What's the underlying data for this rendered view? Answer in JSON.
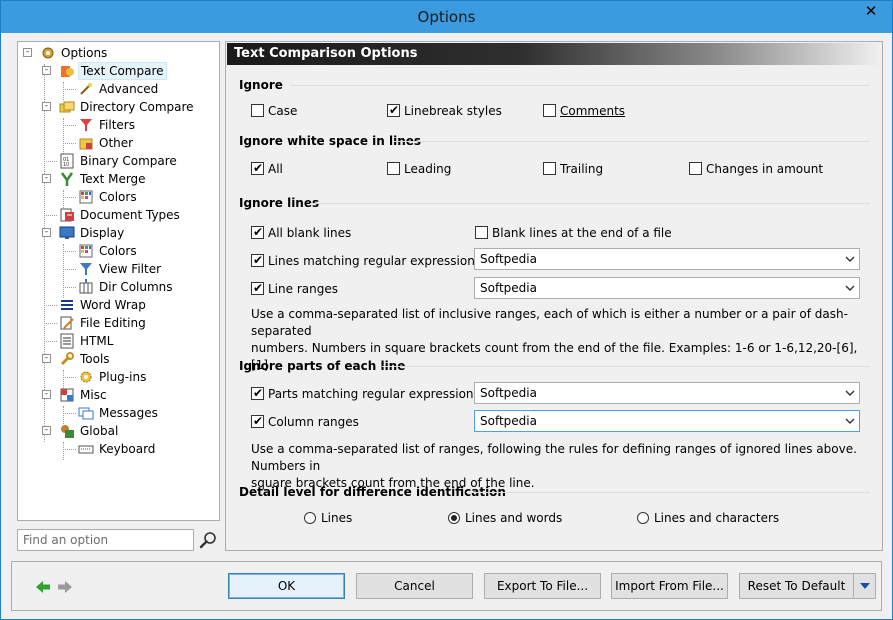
{
  "window": {
    "title": "Options",
    "close_glyph": "✕"
  },
  "tree": {
    "items": [
      {
        "label": "Options",
        "icon": "options-gear-icon"
      },
      {
        "label": "Text Compare",
        "icon": "text-compare-icon"
      },
      {
        "label": "Advanced",
        "icon": "advanced-wand-icon"
      },
      {
        "label": "Directory Compare",
        "icon": "folders-icon"
      },
      {
        "label": "Filters",
        "icon": "filter-funnel-icon"
      },
      {
        "label": "Other",
        "icon": "other-folder-icon"
      },
      {
        "label": "Binary Compare",
        "icon": "binary-icon"
      },
      {
        "label": "Text Merge",
        "icon": "merge-icon"
      },
      {
        "label": "Colors",
        "icon": "color-grid-icon"
      },
      {
        "label": "Document Types",
        "icon": "document-types-icon"
      },
      {
        "label": "Display",
        "icon": "monitor-icon"
      },
      {
        "label": "Colors",
        "icon": "color-grid-icon"
      },
      {
        "label": "View Filter",
        "icon": "view-filter-icon"
      },
      {
        "label": "Dir Columns",
        "icon": "dir-columns-icon"
      },
      {
        "label": "Word Wrap",
        "icon": "word-wrap-icon"
      },
      {
        "label": "File Editing",
        "icon": "file-editing-icon"
      },
      {
        "label": "HTML",
        "icon": "html-icon"
      },
      {
        "label": "Tools",
        "icon": "tools-wrench-icon"
      },
      {
        "label": "Plug-ins",
        "icon": "plugin-gear-icon"
      },
      {
        "label": "Misc",
        "icon": "misc-icon"
      },
      {
        "label": "Messages",
        "icon": "messages-icon"
      },
      {
        "label": "Global",
        "icon": "global-icon"
      },
      {
        "label": "Keyboard",
        "icon": "keyboard-icon"
      }
    ],
    "find_placeholder": "Find an option"
  },
  "panel": {
    "header": "Text Comparison Options",
    "ignore": {
      "title": "Ignore",
      "case": {
        "label": "Case",
        "checked": false
      },
      "linebreak": {
        "label": "Linebreak styles",
        "checked": true
      },
      "comments": {
        "label": "Comments",
        "checked": false
      }
    },
    "whitespace": {
      "title": "Ignore white space in lines",
      "all": {
        "label": "All",
        "checked": true
      },
      "leading": {
        "label": "Leading",
        "checked": false
      },
      "trailing": {
        "label": "Trailing",
        "checked": false
      },
      "changes": {
        "label": "Changes in amount",
        "checked": false
      }
    },
    "lines": {
      "title": "Ignore lines",
      "blank": {
        "label": "All blank lines",
        "checked": true
      },
      "blank_end": {
        "label": "Blank lines at the end of a file",
        "checked": false
      },
      "regex": {
        "label": "Lines matching regular expression",
        "checked": true,
        "value": "Softpedia"
      },
      "ranges": {
        "label": "Line ranges",
        "checked": true,
        "value": "Softpedia"
      },
      "help1": "Use a comma-separated list of inclusive ranges, each of which is either a number or a pair of dash-separated",
      "help2": "numbers. Numbers in square brackets count from the end of the file. Examples: 1-6 or 1-6,12,20-[6],[1]"
    },
    "parts": {
      "title": "Ignore parts of each line",
      "regex": {
        "label": "Parts matching regular expression",
        "checked": true,
        "value": "Softpedia"
      },
      "columns": {
        "label": "Column ranges",
        "checked": true,
        "value": "Softpedia"
      },
      "help1": "Use a comma-separated list of ranges, following the rules for defining ranges of ignored lines above. Numbers in",
      "help2": "square brackets count from the end of the line."
    },
    "detail": {
      "title": "Detail level for difference identification",
      "lines": "Lines",
      "words": "Lines and words",
      "chars": "Lines and characters",
      "selected": "words"
    }
  },
  "buttons": {
    "ok": "OK",
    "cancel": "Cancel",
    "export": "Export To File...",
    "import": "Import From File...",
    "reset": "Reset To Default"
  },
  "colors": {
    "title_bar": "#3c9bdf",
    "nav_back": "#2ea32e",
    "nav_forward": "#9a9a9a"
  }
}
